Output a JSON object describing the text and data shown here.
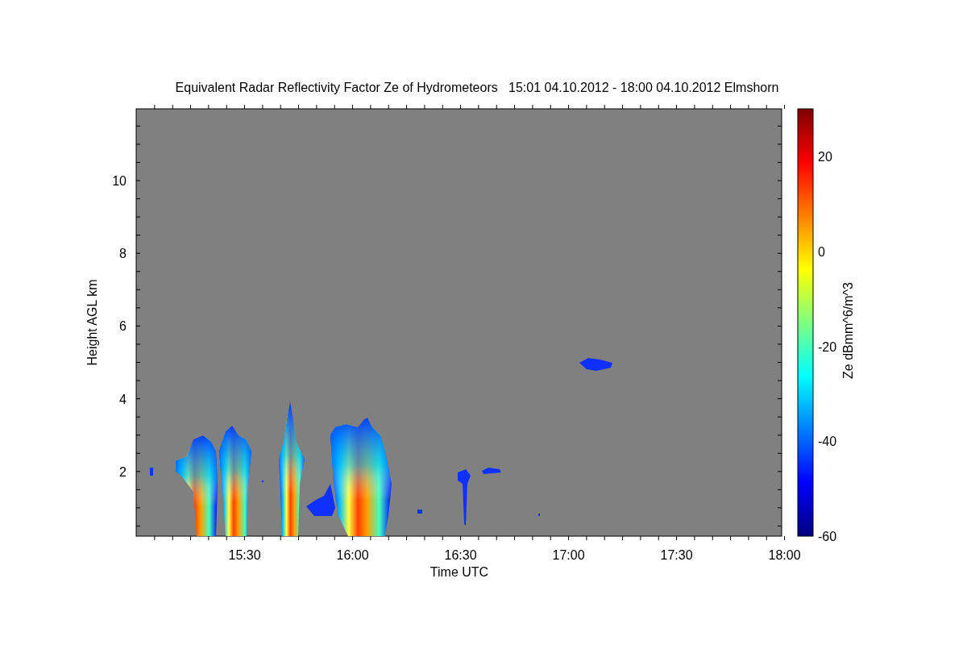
{
  "title": "Equivalent Radar Reflectivity Factor Ze of Hydrometeors   15:01 04.10.2012 - 18:00 04.10.2012 Elmshorn",
  "y_axis": {
    "label": "Height AGL km",
    "ticks": [
      "10",
      "8",
      "6",
      "4",
      "2"
    ]
  },
  "x_axis": {
    "label": "Time UTC",
    "ticks": [
      "15:30",
      "16:00",
      "16:30",
      "17:00",
      "17:30",
      "18:00"
    ]
  },
  "colorbar": {
    "label": "Ze dBmm^6/m^3",
    "ticks": [
      "20",
      "0",
      "-20",
      "-40",
      "-60"
    ]
  }
}
